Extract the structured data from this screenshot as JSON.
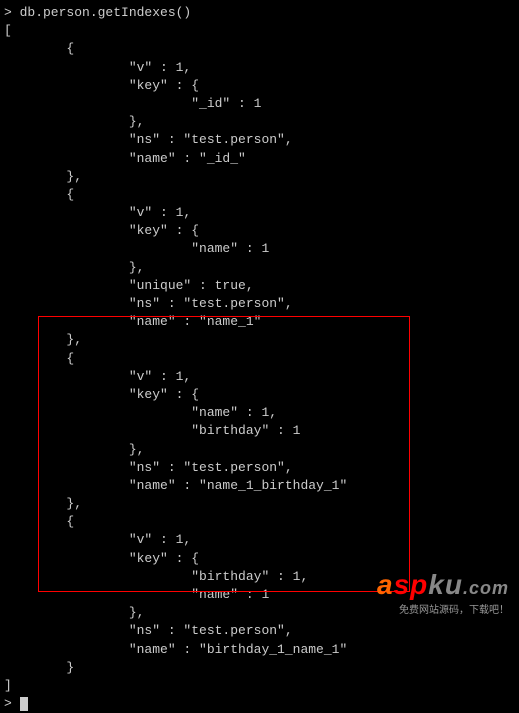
{
  "prompt_char": ">",
  "command": "db.person.getIndexes()",
  "output_open": "[",
  "indexes": [
    {
      "open": "        {",
      "v": "                \"v\" : 1,",
      "key_open": "                \"key\" : {",
      "key_fields": [
        "                        \"_id\" : 1"
      ],
      "key_close": "                },",
      "extra": [],
      "ns": "                \"ns\" : \"test.person\",",
      "name": "                \"name\" : \"_id_\"",
      "close": "        },"
    },
    {
      "open": "        {",
      "v": "                \"v\" : 1,",
      "key_open": "                \"key\" : {",
      "key_fields": [
        "                        \"name\" : 1"
      ],
      "key_close": "                },",
      "extra": [
        "                \"unique\" : true,"
      ],
      "ns": "                \"ns\" : \"test.person\",",
      "name": "                \"name\" : \"name_1\"",
      "close": "        },"
    },
    {
      "open": "        {",
      "v": "                \"v\" : 1,",
      "key_open": "                \"key\" : {",
      "key_fields": [
        "                        \"name\" : 1,",
        "                        \"birthday\" : 1"
      ],
      "key_close": "                },",
      "extra": [],
      "ns": "                \"ns\" : \"test.person\",",
      "name": "                \"name\" : \"name_1_birthday_1\"",
      "close": "        },"
    },
    {
      "open": "        {",
      "v": "                \"v\" : 1,",
      "key_open": "                \"key\" : {",
      "key_fields": [
        "                        \"birthday\" : 1,",
        "                        \"name\" : 1"
      ],
      "key_close": "                },",
      "extra": [],
      "ns": "                \"ns\" : \"test.person\",",
      "name": "                \"name\" : \"birthday_1_name_1\"",
      "close": "        }"
    }
  ],
  "output_close": "]",
  "logo": {
    "a": "a",
    "sp": "sp",
    "ku": "ku",
    "com": ".com",
    "sub": "免费网站源码，下载吧！"
  }
}
